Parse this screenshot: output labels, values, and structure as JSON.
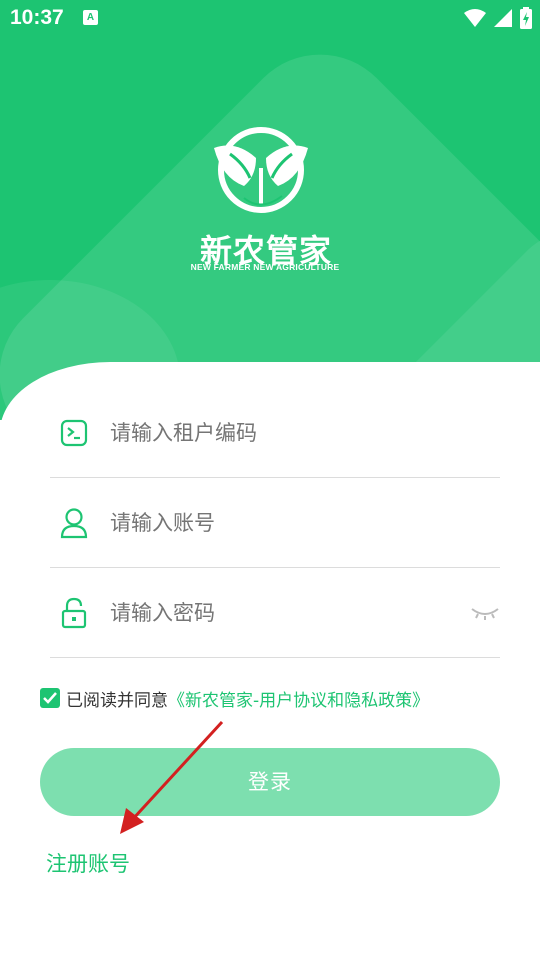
{
  "status_bar": {
    "time": "10:37",
    "notification_icon": "A"
  },
  "brand": {
    "title": "新农管家",
    "subtitle": "NEW FARMER NEW AGRICULTURE",
    "logo_icon": "sprout-leaf-logo"
  },
  "form": {
    "tenant_placeholder": "请输入租户编码",
    "account_placeholder": "请输入账号",
    "password_placeholder": "请输入密码"
  },
  "agreement": {
    "checked": true,
    "prefix": "已阅读并同意",
    "link": "《新农管家-用户协议和隐私政策》"
  },
  "login_button": "登录",
  "register_link": "注册账号",
  "colors": {
    "primary": "#1dc472",
    "button_disabled": "#7ddfaf",
    "annotation_arrow": "#d32020"
  }
}
